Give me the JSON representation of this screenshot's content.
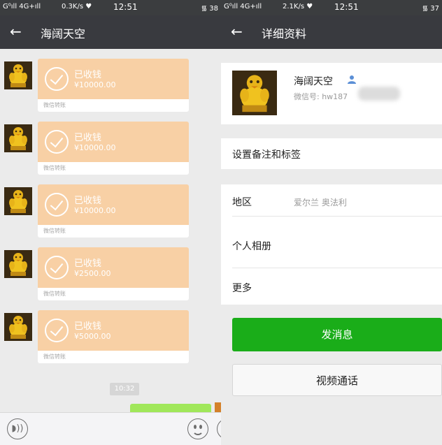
{
  "left": {
    "status": {
      "signal": "G⁰ıll 4G+ıll",
      "speed": "0.3K/s ♥",
      "time": "12:51",
      "wifi": "᯾ 38"
    },
    "header": {
      "back_glyph": "←",
      "title": "海阔天空"
    },
    "messages": [
      {
        "status": "已收钱",
        "amount": "¥10000.00",
        "tag": "微信转账"
      },
      {
        "status": "已收钱",
        "amount": "¥10000.00",
        "tag": "微信转账"
      },
      {
        "status": "已收钱",
        "amount": "¥10000.00",
        "tag": "微信转账"
      },
      {
        "status": "已收钱",
        "amount": "¥2500.00",
        "tag": "微信转账"
      },
      {
        "status": "已收钱",
        "amount": "¥5000.00",
        "tag": "微信转账"
      }
    ],
    "time_chip": "10:32",
    "voice_glyph": "◗))"
  },
  "right": {
    "status": {
      "signal": "G⁰ıll 4G+ıll",
      "speed": "2.1K/s ♥",
      "time": "12:51",
      "wifi": "᯾ 37"
    },
    "header": {
      "back_glyph": "←",
      "title": "详细资料"
    },
    "profile": {
      "name": "海阔天空",
      "wechat_id": "微信号: hw187"
    },
    "remark_row": "设置备注和标签",
    "rows": [
      {
        "label": "地区",
        "value": "爱尔兰  奥法利"
      },
      {
        "label": "个人相册",
        "value": ""
      },
      {
        "label": "更多",
        "value": ""
      }
    ],
    "send_message": "发消息",
    "video_call": "视频通话"
  },
  "colors": {
    "titlebar": "#393a3f",
    "transfer_card": "#f8d0a5",
    "green_button": "#1aad19",
    "background": "#ebebeb"
  }
}
